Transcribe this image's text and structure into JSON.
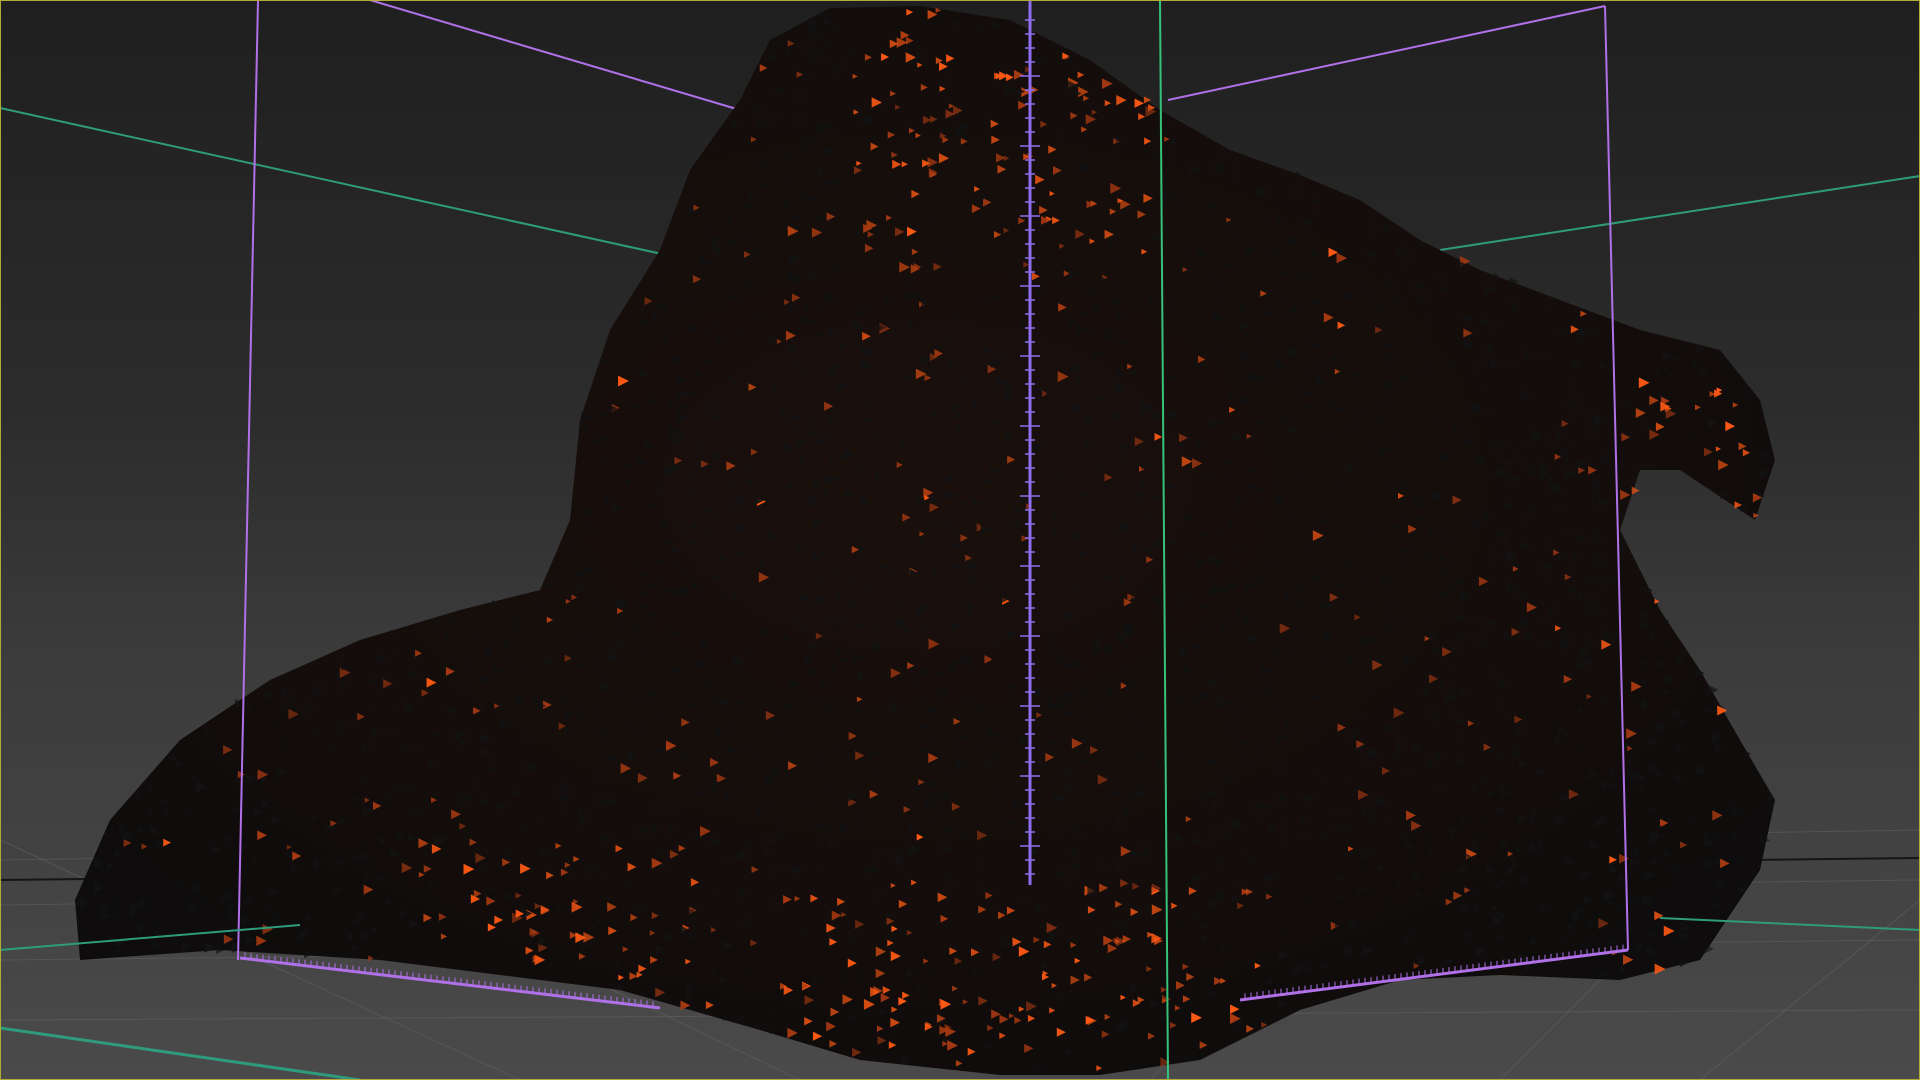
{
  "viewport": {
    "name": "3d-perspective-viewport",
    "camera": "perspective",
    "colors": {
      "background_top": "#1f1f1f",
      "background_bottom": "#4a4a4a",
      "viewport_border": "#b3a83a",
      "ground_grid": "#606060",
      "grid_axis_x": "#2e9c7c",
      "bounding_box_edges": "#b070e8",
      "bounding_box_green_edges": "#36c27a",
      "volume_axis_line": "#8f6ff0",
      "voxel_dark": "#121212",
      "voxel_hot": "#ff5a14",
      "voxel_warm": "#a83a12"
    },
    "icons": [
      "voxel-triangle-glyph"
    ]
  },
  "scene": {
    "object": "voxel-volume-preview",
    "voxel_glyph": "triangle-arrow",
    "bounding_box": "visible",
    "ground_grid": "visible",
    "center_axis": "visible"
  }
}
